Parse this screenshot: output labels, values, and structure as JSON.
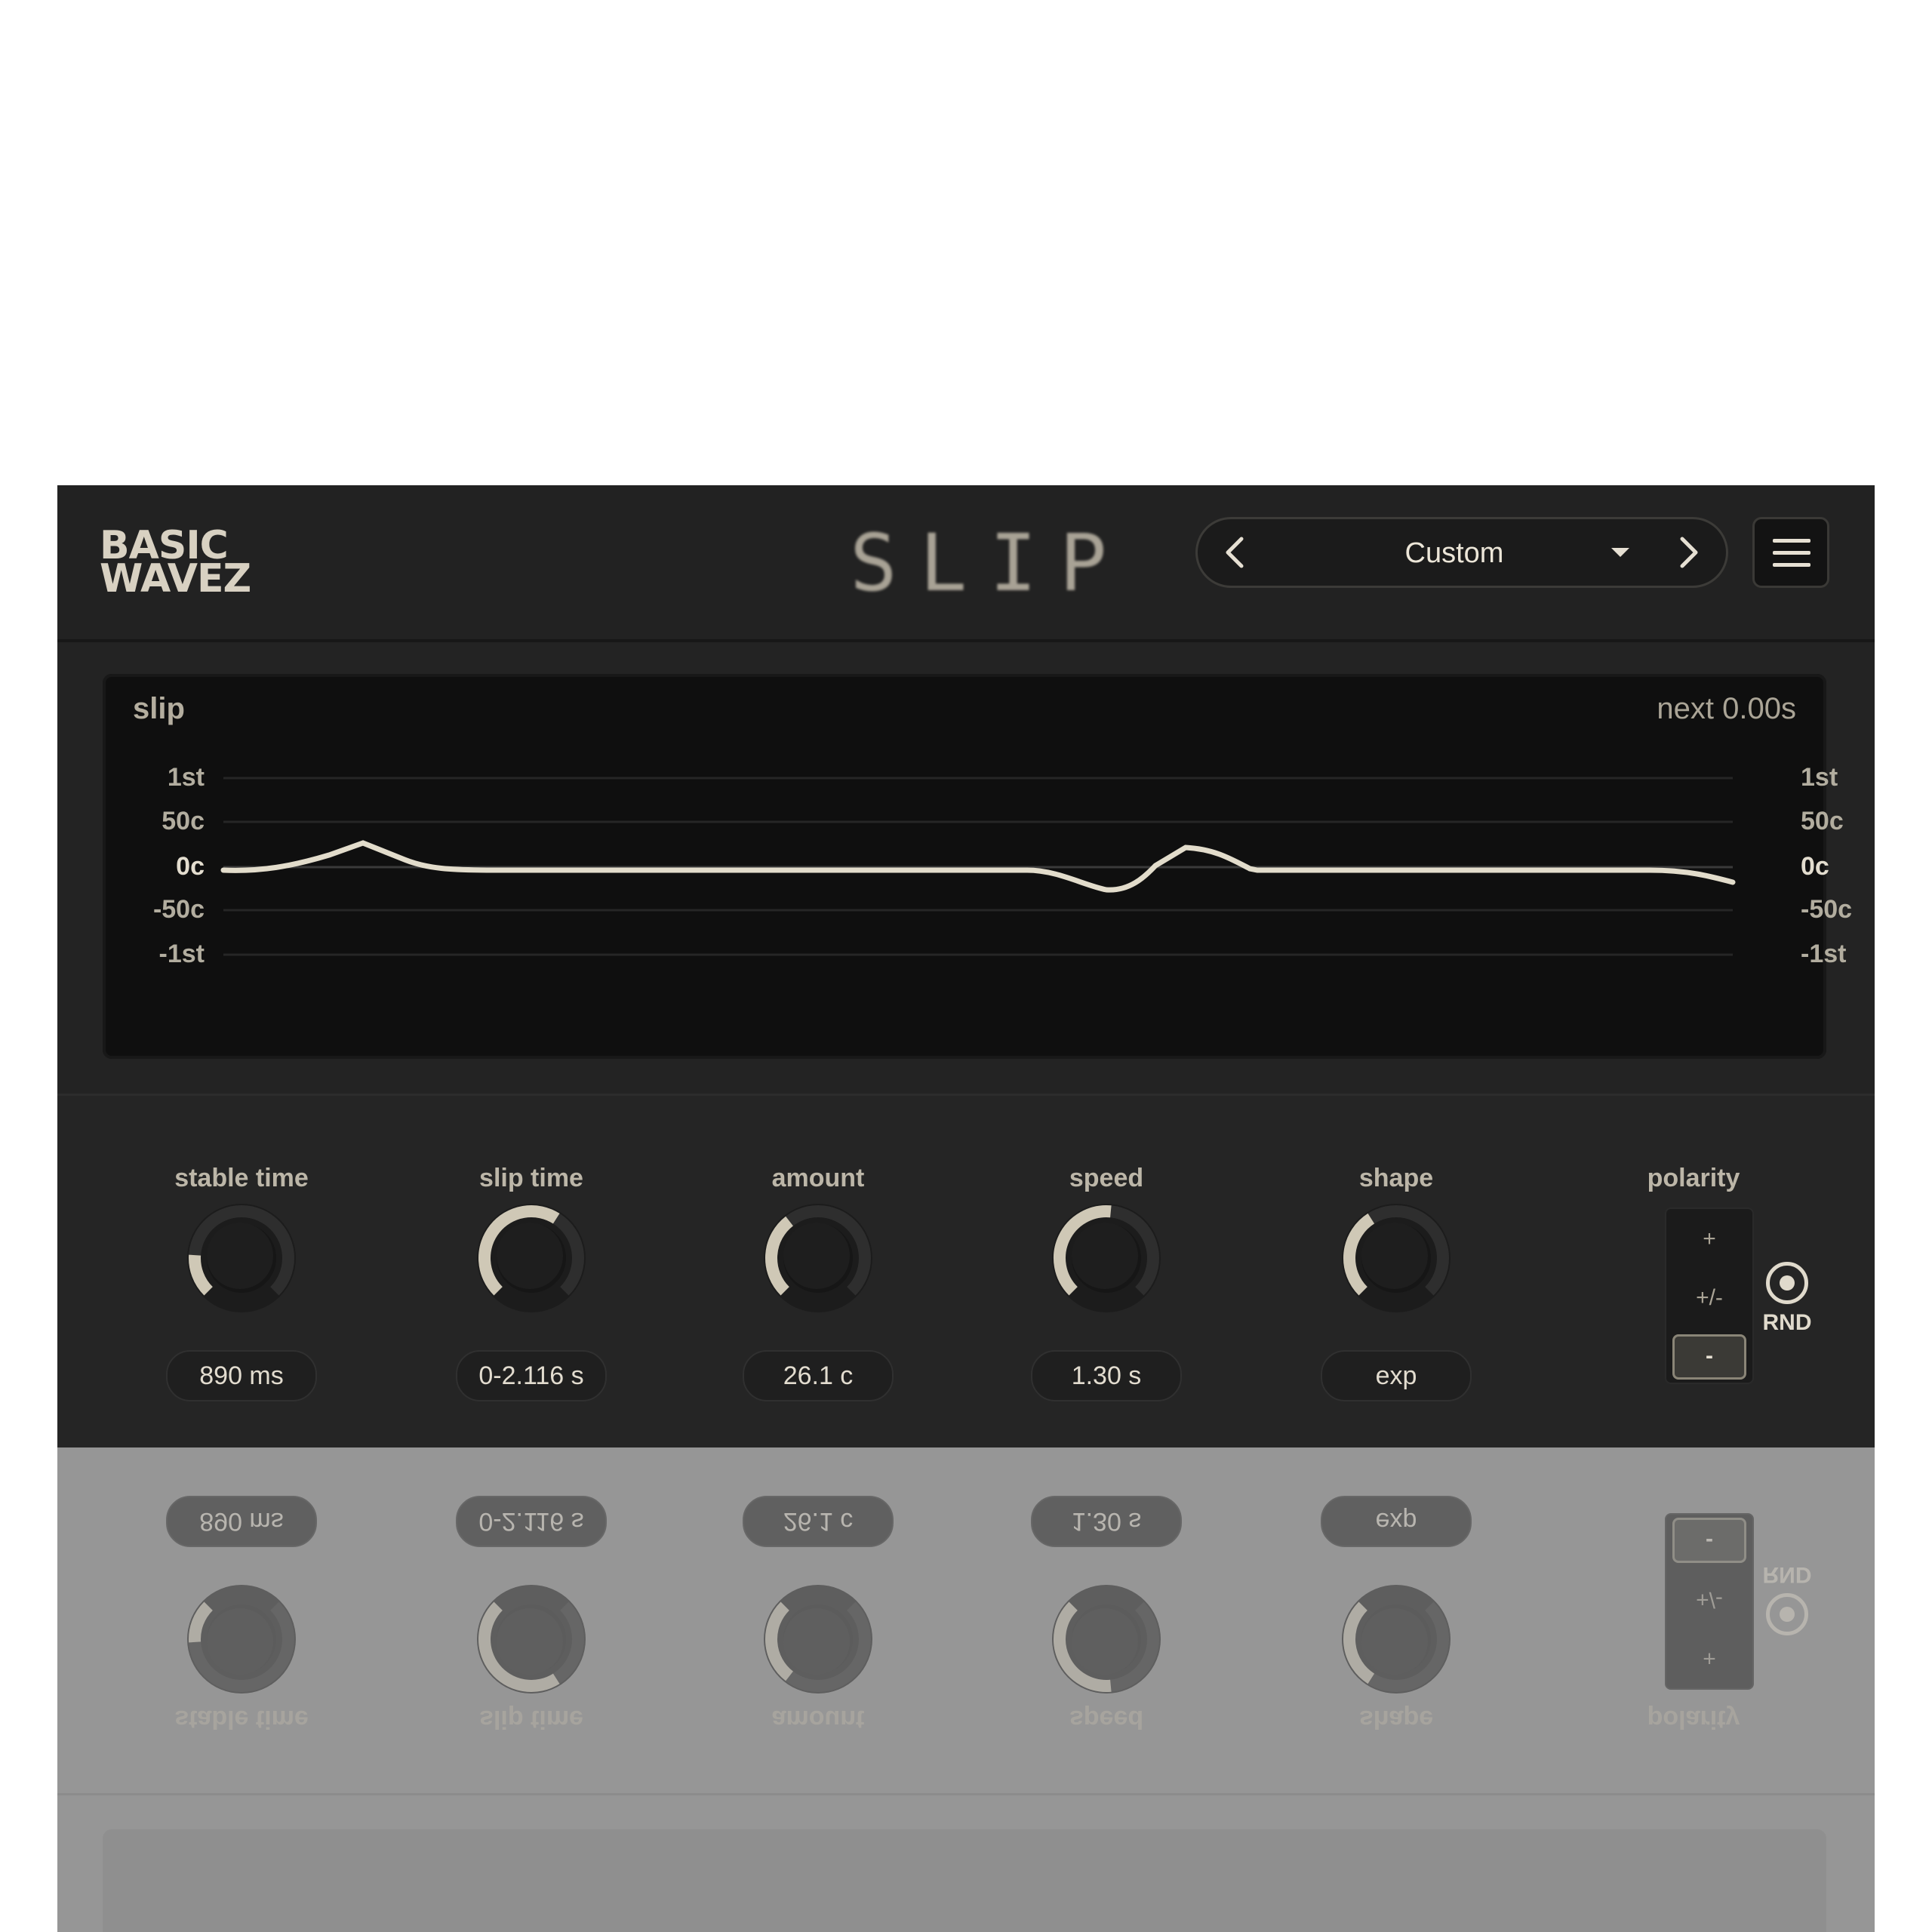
{
  "header": {
    "logo_line1": "BASIC",
    "logo_line2": "WAVEZ",
    "product_title": "SLIP",
    "preset_name": "Custom",
    "prev_glyph": "‹",
    "next_glyph": "›"
  },
  "display": {
    "title": "slip",
    "next_label": "next 0.00s",
    "y_labels": [
      "1st",
      "50c",
      "0c",
      "-50c",
      "-1st"
    ],
    "y_values_cents": [
      100,
      50,
      0,
      -50,
      -100
    ],
    "curve_color": "#e2dccb"
  },
  "controls": [
    {
      "id": "stable-time",
      "label": "stable time",
      "value": "890 ms",
      "fill": 0.18
    },
    {
      "id": "slip-time",
      "label": "slip time",
      "value": "0-2.116 s",
      "fill": 0.62
    },
    {
      "id": "amount",
      "label": "amount",
      "value": "26.1 c",
      "fill": 0.36
    },
    {
      "id": "speed",
      "label": "speed",
      "value": "1.30 s",
      "fill": 0.52
    },
    {
      "id": "shape",
      "label": "shape",
      "value": "exp",
      "fill": 0.38
    }
  ],
  "polarity": {
    "label": "polarity",
    "options": [
      "+",
      "+/-",
      "-"
    ],
    "selected": "-"
  },
  "rnd": {
    "label": "RND",
    "enabled": true
  },
  "colors": {
    "accent": "#cfc8b6",
    "panel": "#232323",
    "display_bg": "#0f0f0f"
  }
}
